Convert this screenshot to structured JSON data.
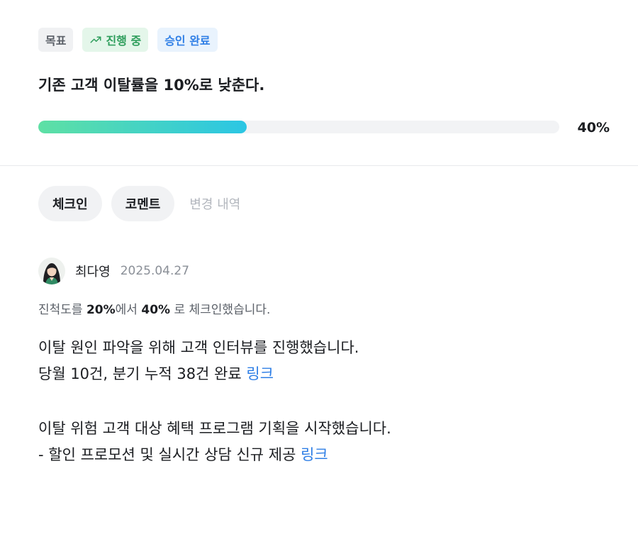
{
  "tags": {
    "goal": "목표",
    "progress": "진행 중",
    "approved": "승인 완료"
  },
  "goal": {
    "title": "기존 고객 이탈률을 10%로 낮춘다.",
    "progress": 0.4,
    "progress_label": "40%"
  },
  "tabs": [
    {
      "label": "체크인"
    },
    {
      "label": "코멘트"
    },
    {
      "label": "변경 내역"
    }
  ],
  "entry": {
    "author": "최다영",
    "date": "2025.04.27",
    "checkin_prefix": "진척도를 ",
    "checkin_from": "20%",
    "checkin_mid": "에서 ",
    "checkin_to": "40%",
    "checkin_suffix": " 로 체크인했습니다.",
    "lines": [
      "이탈 원인 파악을 위해 고객 인터뷰를 진행했습니다.",
      "당월 10건, 분기 누적 38건 완료 ",
      "이탈 위험 고객 대상 혜택 프로그램 기획을 시작했습니다.",
      "- 할인 프로모션 및 실시간 상담 신규 제공 "
    ],
    "link_label": "링크"
  },
  "colors": {
    "accent": "#2f7fe6",
    "progress_start": "#5ee0a4",
    "progress_end": "#2bc6e4"
  }
}
